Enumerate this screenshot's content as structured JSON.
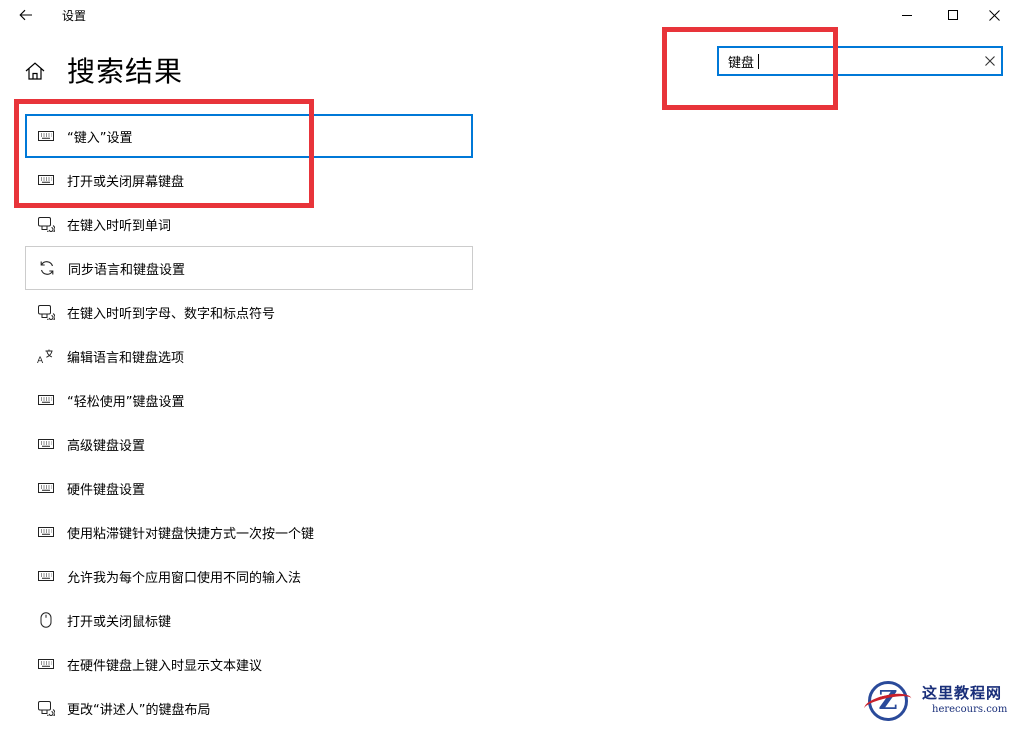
{
  "window": {
    "title": "设置"
  },
  "page": {
    "title": "搜索结果"
  },
  "search": {
    "value": "键盘",
    "placeholder": ""
  },
  "results": [
    {
      "label": "“键入”设置",
      "icon": "keyboard-icon"
    },
    {
      "label": "打开或关闭屏幕键盘",
      "icon": "keyboard-icon"
    },
    {
      "label": "在键入时听到单词",
      "icon": "narrator-icon"
    },
    {
      "label": "同步语言和键盘设置",
      "icon": "sync-icon"
    },
    {
      "label": "在键入时听到字母、数字和标点符号",
      "icon": "narrator-icon"
    },
    {
      "label": "编辑语言和键盘选项",
      "icon": "language-icon"
    },
    {
      "label": "“轻松使用”键盘设置",
      "icon": "keyboard-icon"
    },
    {
      "label": "高级键盘设置",
      "icon": "keyboard-icon"
    },
    {
      "label": "硬件键盘设置",
      "icon": "keyboard-icon"
    },
    {
      "label": "使用粘滞键针对键盘快捷方式一次按一个键",
      "icon": "keyboard-icon"
    },
    {
      "label": "允许我为每个应用窗口使用不同的输入法",
      "icon": "keyboard-icon"
    },
    {
      "label": "打开或关闭鼠标键",
      "icon": "mouse-icon"
    },
    {
      "label": "在硬件键盘上键入时显示文本建议",
      "icon": "keyboard-icon"
    },
    {
      "label": "更改“讲述人”的键盘布局",
      "icon": "narrator-icon"
    }
  ],
  "watermark": {
    "title": "这里教程网",
    "url": "herecours.com"
  },
  "colors": {
    "accent": "#0078d7",
    "annotation": "#e8343a"
  }
}
